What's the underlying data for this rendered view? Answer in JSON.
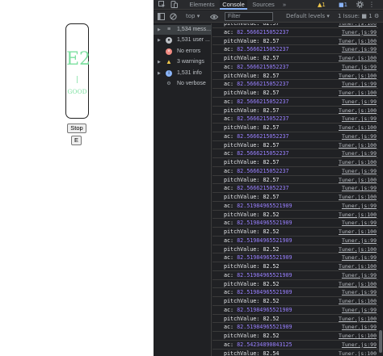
{
  "page": {
    "note": "E2",
    "bar": "|",
    "status": "GOOD",
    "stop_label": "Stop",
    "e_label": "E"
  },
  "devtools": {
    "tabs": [
      "Elements",
      "Console",
      "Sources"
    ],
    "active_tab": "Console",
    "more_tabs": "»",
    "warning_badge": "▲1",
    "issue_badge": "■1",
    "toolbar": {
      "context": "top ▾",
      "filter_placeholder": "Filter",
      "levels": "Default levels ▾",
      "issues": "1 Issue: ■ 1"
    },
    "sidebar": [
      {
        "label": "1,534 mess...",
        "icon": "list-icon"
      },
      {
        "label": "1,531 user ...",
        "icon": "user-icon"
      },
      {
        "label": "No errors",
        "icon": "error-icon"
      },
      {
        "label": "3 warnings",
        "icon": "warning-icon"
      },
      {
        "label": "1,531 info",
        "icon": "info-icon"
      },
      {
        "label": "No verbose",
        "icon": "verbose-icon"
      }
    ],
    "log": [
      {
        "prefix": "pitchValue: ",
        "value": "82.57",
        "src": "Tuner.js:100",
        "num": false
      },
      {
        "prefix": "ac: ",
        "value": "82.5666215052237",
        "src": "Tuner.js:99",
        "num": true
      },
      {
        "prefix": "pitchValue: ",
        "value": "82.57",
        "src": "Tuner.js:100",
        "num": false
      },
      {
        "prefix": "ac: ",
        "value": "82.5666215052237",
        "src": "Tuner.js:99",
        "num": true
      },
      {
        "prefix": "pitchValue: ",
        "value": "82.57",
        "src": "Tuner.js:100",
        "num": false
      },
      {
        "prefix": "ac: ",
        "value": "82.5666215052237",
        "src": "Tuner.js:99",
        "num": true
      },
      {
        "prefix": "pitchValue: ",
        "value": "82.57",
        "src": "Tuner.js:100",
        "num": false
      },
      {
        "prefix": "ac: ",
        "value": "82.5666215052237",
        "src": "Tuner.js:99",
        "num": true
      },
      {
        "prefix": "pitchValue: ",
        "value": "82.57",
        "src": "Tuner.js:100",
        "num": false
      },
      {
        "prefix": "ac: ",
        "value": "82.5666215052237",
        "src": "Tuner.js:99",
        "num": true
      },
      {
        "prefix": "pitchValue: ",
        "value": "82.57",
        "src": "Tuner.js:100",
        "num": false
      },
      {
        "prefix": "ac: ",
        "value": "82.5666215052237",
        "src": "Tuner.js:99",
        "num": true
      },
      {
        "prefix": "pitchValue: ",
        "value": "82.57",
        "src": "Tuner.js:100",
        "num": false
      },
      {
        "prefix": "ac: ",
        "value": "82.5666215052237",
        "src": "Tuner.js:99",
        "num": true
      },
      {
        "prefix": "pitchValue: ",
        "value": "82.57",
        "src": "Tuner.js:100",
        "num": false
      },
      {
        "prefix": "ac: ",
        "value": "82.5666215052237",
        "src": "Tuner.js:99",
        "num": true
      },
      {
        "prefix": "pitchValue: ",
        "value": "82.57",
        "src": "Tuner.js:100",
        "num": false
      },
      {
        "prefix": "ac: ",
        "value": "82.5666215052237",
        "src": "Tuner.js:99",
        "num": true
      },
      {
        "prefix": "pitchValue: ",
        "value": "82.57",
        "src": "Tuner.js:100",
        "num": false
      },
      {
        "prefix": "ac: ",
        "value": "82.5666215052237",
        "src": "Tuner.js:99",
        "num": true
      },
      {
        "prefix": "pitchValue: ",
        "value": "82.57",
        "src": "Tuner.js:100",
        "num": false
      },
      {
        "prefix": "ac: ",
        "value": "82.51984965521909",
        "src": "Tuner.js:99",
        "num": true
      },
      {
        "prefix": "pitchValue: ",
        "value": "82.52",
        "src": "Tuner.js:100",
        "num": false
      },
      {
        "prefix": "ac: ",
        "value": "82.51984965521909",
        "src": "Tuner.js:99",
        "num": true
      },
      {
        "prefix": "pitchValue: ",
        "value": "82.52",
        "src": "Tuner.js:100",
        "num": false
      },
      {
        "prefix": "ac: ",
        "value": "82.51984965521909",
        "src": "Tuner.js:99",
        "num": true
      },
      {
        "prefix": "pitchValue: ",
        "value": "82.52",
        "src": "Tuner.js:100",
        "num": false
      },
      {
        "prefix": "ac: ",
        "value": "82.51984965521909",
        "src": "Tuner.js:99",
        "num": true
      },
      {
        "prefix": "pitchValue: ",
        "value": "82.52",
        "src": "Tuner.js:100",
        "num": false
      },
      {
        "prefix": "ac: ",
        "value": "82.51984965521909",
        "src": "Tuner.js:99",
        "num": true
      },
      {
        "prefix": "pitchValue: ",
        "value": "82.52",
        "src": "Tuner.js:100",
        "num": false
      },
      {
        "prefix": "ac: ",
        "value": "82.51984965521909",
        "src": "Tuner.js:99",
        "num": true
      },
      {
        "prefix": "pitchValue: ",
        "value": "82.52",
        "src": "Tuner.js:100",
        "num": false
      },
      {
        "prefix": "ac: ",
        "value": "82.51984965521909",
        "src": "Tuner.js:99",
        "num": true
      },
      {
        "prefix": "pitchValue: ",
        "value": "82.52",
        "src": "Tuner.js:100",
        "num": false
      },
      {
        "prefix": "ac: ",
        "value": "82.51984965521909",
        "src": "Tuner.js:99",
        "num": true
      },
      {
        "prefix": "pitchValue: ",
        "value": "82.52",
        "src": "Tuner.js:100",
        "num": false
      },
      {
        "prefix": "ac: ",
        "value": "82.54234890843125",
        "src": "Tuner.js:99",
        "num": true
      },
      {
        "prefix": "pitchValue: ",
        "value": "82.54",
        "src": "Tuner.js:100",
        "num": false
      }
    ]
  },
  "colors": {
    "tuner_green": "#7ee0a1",
    "devtools_bg": "#202124",
    "number_purple": "#9980ff",
    "active_tab_underline": "#8ab4f8",
    "warning_yellow": "#f2c94c",
    "error_red": "#f28b82",
    "info_blue": "#8ab4f8"
  }
}
